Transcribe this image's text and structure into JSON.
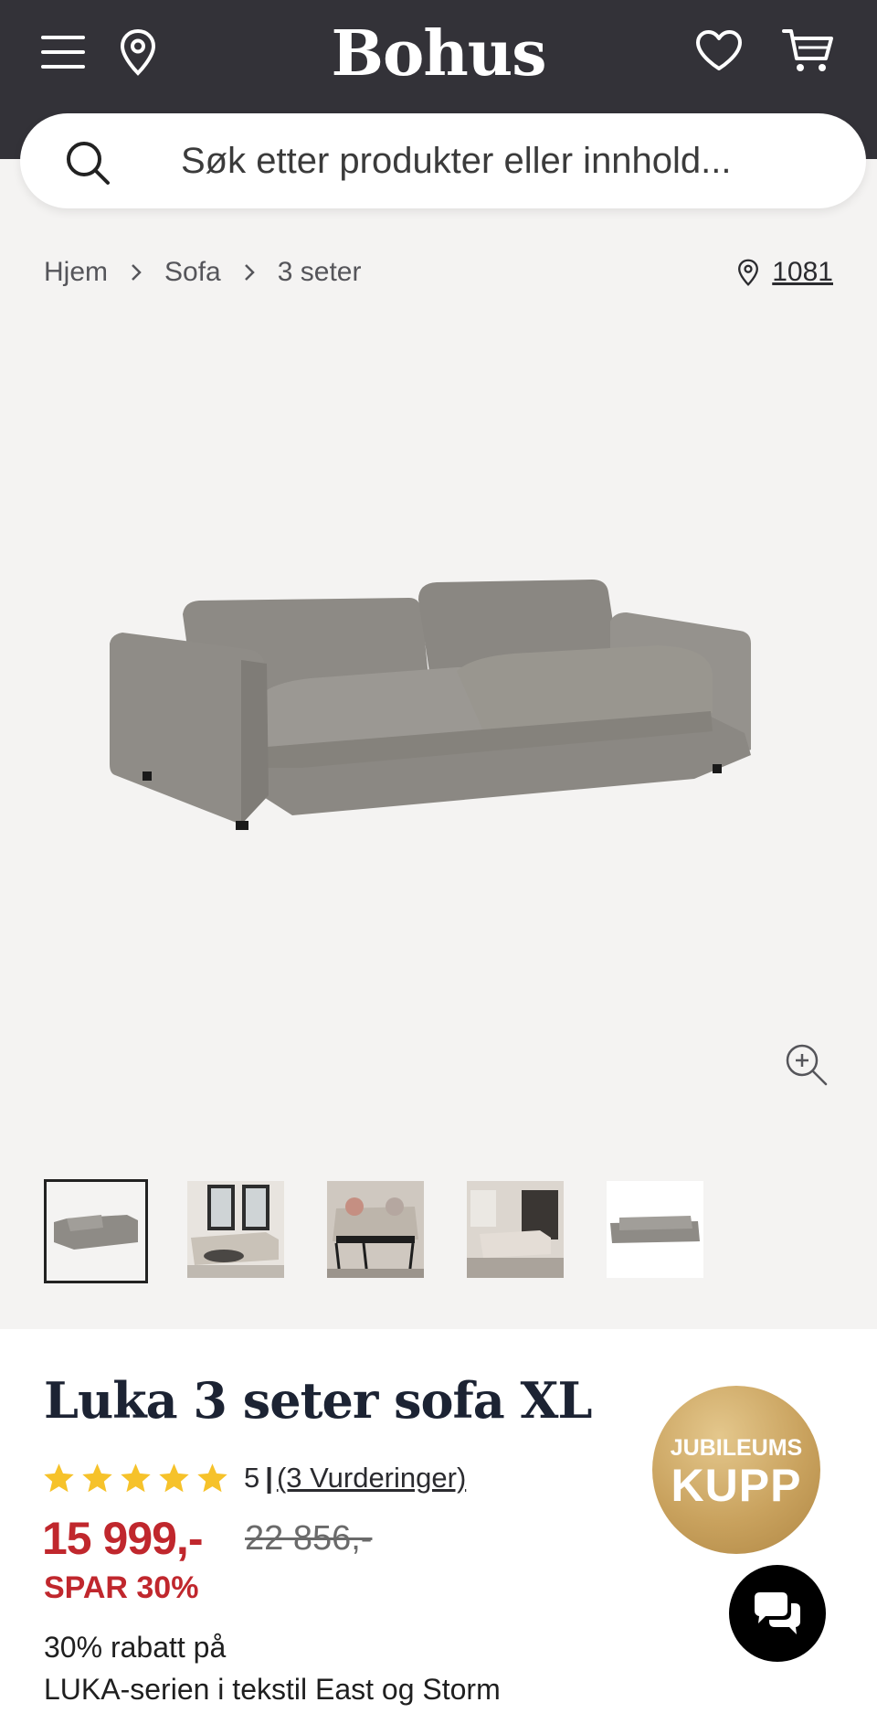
{
  "header": {
    "logo": "Bohus",
    "icons": [
      "menu-icon",
      "location-pin-icon",
      "heart-icon",
      "cart-icon"
    ]
  },
  "search": {
    "placeholder": "Søk etter produkter eller innhold..."
  },
  "breadcrumb": {
    "items": [
      "Hjem",
      "Sofa",
      "3 seter"
    ]
  },
  "store": {
    "code": "1081"
  },
  "gallery": {
    "thumbnails_count": 5,
    "selected_index": 0
  },
  "product": {
    "title": "Luka 3 seter sofa XL",
    "rating_value": "5",
    "rating_separator": "|",
    "reviews_label": "(3 Vurderinger)",
    "stars": 5,
    "price": "15 999,-",
    "old_price": "22 856,-",
    "save_label": "SPAR 30%",
    "promo_line1": "30% rabatt på",
    "promo_line2": "LUKA-serien i tekstil East og Storm"
  },
  "badge": {
    "line1": "JUBILEUMS",
    "line2": "KUPP"
  },
  "colors": {
    "header_bg": "#333238",
    "page_bg": "#f4f3f2",
    "price_red": "#c0272d",
    "star_yellow": "#f6c22a",
    "title_navy": "#1c2333",
    "badge_gold": "#c9a25e"
  }
}
